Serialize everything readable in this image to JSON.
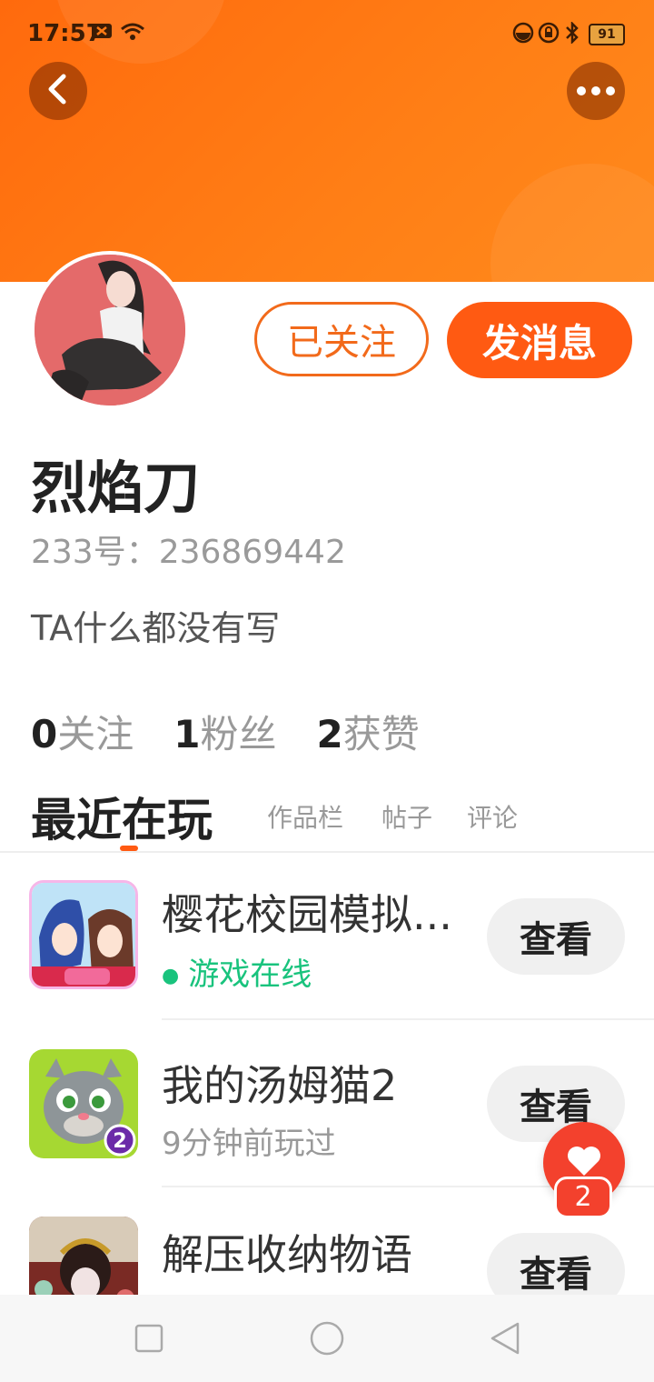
{
  "status_bar": {
    "time": "17:57",
    "battery": "91",
    "icons": [
      "notification-x-icon",
      "wifi-icon",
      "dnd-icon",
      "rotation-lock-icon",
      "bluetooth-icon",
      "battery-icon"
    ]
  },
  "header": {
    "back_icon": "chevron-left-icon",
    "more_icon": "more-dots-icon",
    "background_color": "#ff7a14"
  },
  "profile": {
    "follow_button": "已关注",
    "message_button": "发消息",
    "name": "烈焰刀",
    "uid": "233号：236869442",
    "bio": "TA什么都没有写",
    "stats": [
      {
        "count": "0",
        "label": "关注"
      },
      {
        "count": "1",
        "label": "粉丝"
      },
      {
        "count": "2",
        "label": "获赞"
      }
    ]
  },
  "tabs": {
    "active": "最近在玩",
    "items": [
      "作品栏",
      "帖子",
      "评论"
    ]
  },
  "games": [
    {
      "title": "樱花校园模拟...",
      "subtitle": "游戏在线",
      "status_online": true,
      "button": "查看"
    },
    {
      "title": "我的汤姆猫2",
      "subtitle": "9分钟前玩过",
      "status_online": false,
      "button": "查看"
    },
    {
      "title": "解压收纳物语",
      "subtitle": "",
      "status_online": false,
      "button": "查看"
    }
  ],
  "floating_like": {
    "count": "2",
    "icon": "heart-icon"
  },
  "colors": {
    "accent": "#ff5a12",
    "online": "#19c37d",
    "like": "#f3412d"
  },
  "nav": {
    "icons": [
      "recent-apps-icon",
      "home-icon",
      "back-triangle-icon"
    ]
  }
}
